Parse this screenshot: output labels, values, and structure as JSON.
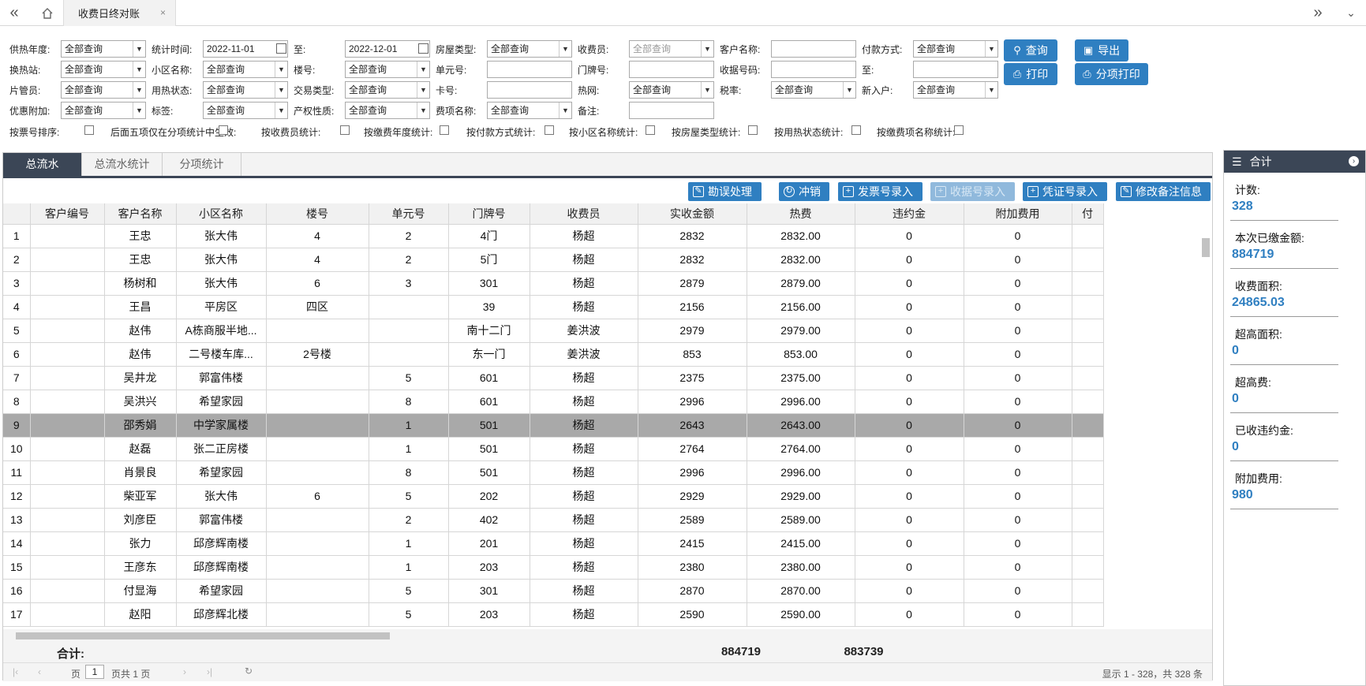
{
  "header": {
    "tab_title": "收费日终对账",
    "close": "×",
    "nav_back": "«",
    "nav_forward": "»",
    "home_icon": "house-icon"
  },
  "filters": {
    "row1": [
      {
        "label": "供热年度:",
        "value": "全部查询",
        "type": "select"
      },
      {
        "label": "统计时间:",
        "value": "2022-11-01",
        "type": "date"
      },
      {
        "label": "至:",
        "value": "2022-12-01",
        "type": "date"
      },
      {
        "label": "房屋类型:",
        "value": "全部查询",
        "type": "select"
      },
      {
        "label": "收费员:",
        "value": "全部查询",
        "type": "select",
        "disabled": true
      },
      {
        "label": "客户名称:",
        "value": "",
        "type": "input"
      },
      {
        "label": "付款方式:",
        "value": "全部查询",
        "type": "select"
      }
    ],
    "row2": [
      {
        "label": "换热站:",
        "value": "全部查询",
        "type": "select"
      },
      {
        "label": "小区名称:",
        "value": "全部查询",
        "type": "select"
      },
      {
        "label": "楼号:",
        "value": "全部查询",
        "type": "select"
      },
      {
        "label": "单元号:",
        "value": "",
        "type": "input"
      },
      {
        "label": "门牌号:",
        "value": "",
        "type": "input"
      },
      {
        "label": "收据号码:",
        "value": "",
        "type": "input"
      },
      {
        "label": "至:",
        "value": "",
        "type": "input"
      }
    ],
    "row3": [
      {
        "label": "片管员:",
        "value": "全部查询",
        "type": "select"
      },
      {
        "label": "用热状态:",
        "value": "全部查询",
        "type": "select"
      },
      {
        "label": "交易类型:",
        "value": "全部查询",
        "type": "select"
      },
      {
        "label": "卡号:",
        "value": "",
        "type": "input"
      },
      {
        "label": "热网:",
        "value": "全部查询",
        "type": "select"
      },
      {
        "label": "税率:",
        "value": "全部查询",
        "type": "select"
      },
      {
        "label": "新入户:",
        "value": "全部查询",
        "type": "select"
      }
    ],
    "row4": [
      {
        "label": "优惠附加:",
        "value": "全部查询",
        "type": "select"
      },
      {
        "label": "标签:",
        "value": "全部查询",
        "type": "select"
      },
      {
        "label": "产权性质:",
        "value": "全部查询",
        "type": "select"
      },
      {
        "label": "费项名称:",
        "value": "全部查询",
        "type": "select"
      },
      {
        "label": "备注:",
        "value": "",
        "type": "input"
      }
    ],
    "checks": [
      "按票号排序:",
      "后面五项仅在分项统计中生效:",
      "按收费员统计:",
      "按缴费年度统计:",
      "按付款方式统计:",
      "按小区名称统计:",
      "按房屋类型统计:",
      "按用热状态统计:",
      "按缴费项名称统计:"
    ],
    "buttons": {
      "query": "查询",
      "export": "导出",
      "print": "打印",
      "split_print": "分项打印"
    }
  },
  "grid": {
    "tabs": [
      "总流水",
      "总流水统计",
      "分项统计"
    ],
    "toolbar": [
      "勘误处理",
      "冲销",
      "发票号录入",
      "收据号录入",
      "凭证号录入",
      "修改备注信息"
    ],
    "columns": [
      "",
      "客户编号",
      "客户名称",
      "小区名称",
      "楼号",
      "单元号",
      "门牌号",
      "收费员",
      "实收金额",
      "热费",
      "违约金",
      "附加费用",
      "付"
    ],
    "rows": [
      [
        "1",
        "",
        "王忠",
        "张大伟",
        "4",
        "2",
        "4门",
        "杨超",
        "2832",
        "2832.00",
        "0",
        "0"
      ],
      [
        "2",
        "",
        "王忠",
        "张大伟",
        "4",
        "2",
        "5门",
        "杨超",
        "2832",
        "2832.00",
        "0",
        "0"
      ],
      [
        "3",
        "",
        "杨树和",
        "张大伟",
        "6",
        "3",
        "301",
        "杨超",
        "2879",
        "2879.00",
        "0",
        "0"
      ],
      [
        "4",
        "",
        "王昌",
        "平房区",
        "四区",
        "",
        "39",
        "杨超",
        "2156",
        "2156.00",
        "0",
        "0"
      ],
      [
        "5",
        "",
        "赵伟",
        "A栋商服半地...",
        "",
        "",
        "南十二门",
        "姜洪波",
        "2979",
        "2979.00",
        "0",
        "0"
      ],
      [
        "6",
        "",
        "赵伟",
        "二号楼车库...",
        "2号楼",
        "",
        "东一门",
        "姜洪波",
        "853",
        "853.00",
        "0",
        "0"
      ],
      [
        "7",
        "",
        "吴井龙",
        "郭富伟楼",
        "",
        "5",
        "601",
        "杨超",
        "2375",
        "2375.00",
        "0",
        "0"
      ],
      [
        "8",
        "",
        "吴洪兴",
        "希望家园",
        "",
        "8",
        "601",
        "杨超",
        "2996",
        "2996.00",
        "0",
        "0"
      ],
      [
        "9",
        "",
        "邵秀娟",
        "中学家属楼",
        "",
        "1",
        "501",
        "杨超",
        "2643",
        "2643.00",
        "0",
        "0"
      ],
      [
        "10",
        "",
        "赵磊",
        "张二正房楼",
        "",
        "1",
        "501",
        "杨超",
        "2764",
        "2764.00",
        "0",
        "0"
      ],
      [
        "11",
        "",
        "肖景良",
        "希望家园",
        "",
        "8",
        "501",
        "杨超",
        "2996",
        "2996.00",
        "0",
        "0"
      ],
      [
        "12",
        "",
        "柴亚军",
        "张大伟",
        "6",
        "5",
        "202",
        "杨超",
        "2929",
        "2929.00",
        "0",
        "0"
      ],
      [
        "13",
        "",
        "刘彦臣",
        "郭富伟楼",
        "",
        "2",
        "402",
        "杨超",
        "2589",
        "2589.00",
        "0",
        "0"
      ],
      [
        "14",
        "",
        "张力",
        "邱彦辉南楼",
        "",
        "1",
        "201",
        "杨超",
        "2415",
        "2415.00",
        "0",
        "0"
      ],
      [
        "15",
        "",
        "王彦东",
        "邱彦辉南楼",
        "",
        "1",
        "203",
        "杨超",
        "2380",
        "2380.00",
        "0",
        "0"
      ],
      [
        "16",
        "",
        "付显海",
        "希望家园",
        "",
        "5",
        "301",
        "杨超",
        "2870",
        "2870.00",
        "0",
        "0"
      ],
      [
        "17",
        "",
        "赵阳",
        "邱彦辉北楼",
        "",
        "5",
        "203",
        "杨超",
        "2590",
        "2590.00",
        "0",
        "0"
      ]
    ],
    "selected_row": 9,
    "total_label": "合计:",
    "total_amount": "884719",
    "total_heat": "883739",
    "pager": {
      "page_label": "页",
      "page": "1",
      "of_label": "页共 1 页",
      "summary": "显示 1 - 328，共 328 条"
    }
  },
  "sidebar": {
    "title": "合计",
    "items": [
      {
        "k": "计数:",
        "v": "328"
      },
      {
        "k": "本次已缴金额:",
        "v": "884719"
      },
      {
        "k": "收费面积:",
        "v": "24865.03"
      },
      {
        "k": "超高面积:",
        "v": "0"
      },
      {
        "k": "超高费:",
        "v": "0"
      },
      {
        "k": "已收违约金:",
        "v": "0"
      },
      {
        "k": "附加费用:",
        "v": "980"
      }
    ]
  },
  "colors": {
    "accent": "#2f7fc1",
    "dark": "#3b4656",
    "selected": "#a9a9a9"
  }
}
